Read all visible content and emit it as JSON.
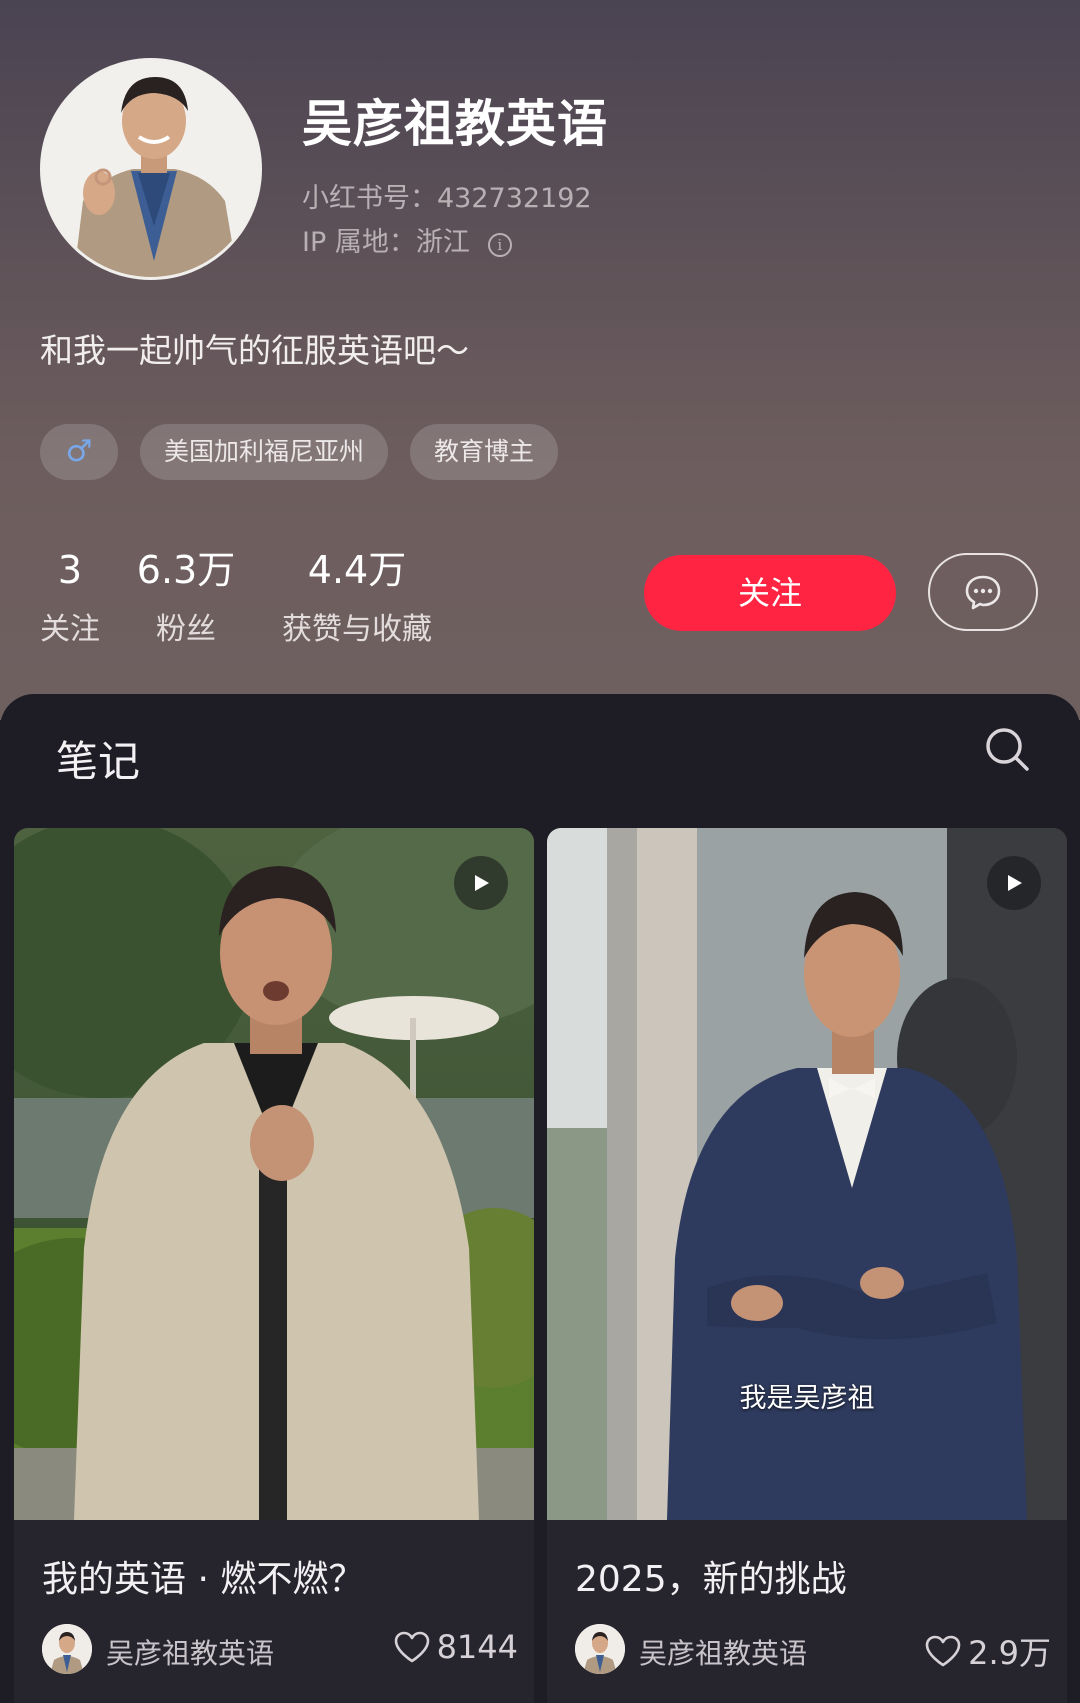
{
  "profile": {
    "name": "吴彦祖教英语",
    "red_id": "小红书号：432732192",
    "ip_location": "IP 属地：浙江",
    "bio": "和我一起帅气的征服英语吧～",
    "tags": {
      "gender_symbol": "♂",
      "location": "美国加利福尼亚州",
      "category": "教育博主"
    },
    "stats": [
      {
        "value": "3",
        "label": "关注"
      },
      {
        "value": "6.3万",
        "label": "粉丝"
      },
      {
        "value": "4.4万",
        "label": "获赞与收藏"
      }
    ],
    "follow_label": "关注",
    "message_icon": "chat-bubble-icon"
  },
  "notes": {
    "tab_label": "笔记",
    "search_icon": "search-icon",
    "cards": [
      {
        "title": "我的英语 · 燃不燃？",
        "author": "吴彦祖教英语",
        "likes": "8144",
        "is_video": true,
        "subtitle": ""
      },
      {
        "title": "2025，新的挑战",
        "author": "吴彦祖教英语",
        "likes": "2.9万",
        "is_video": true,
        "subtitle": "我是吴彦祖"
      }
    ]
  },
  "colors": {
    "accent": "#ff2442",
    "gender_blue": "#79a8ea",
    "panel_bg": "#1e1c24"
  }
}
